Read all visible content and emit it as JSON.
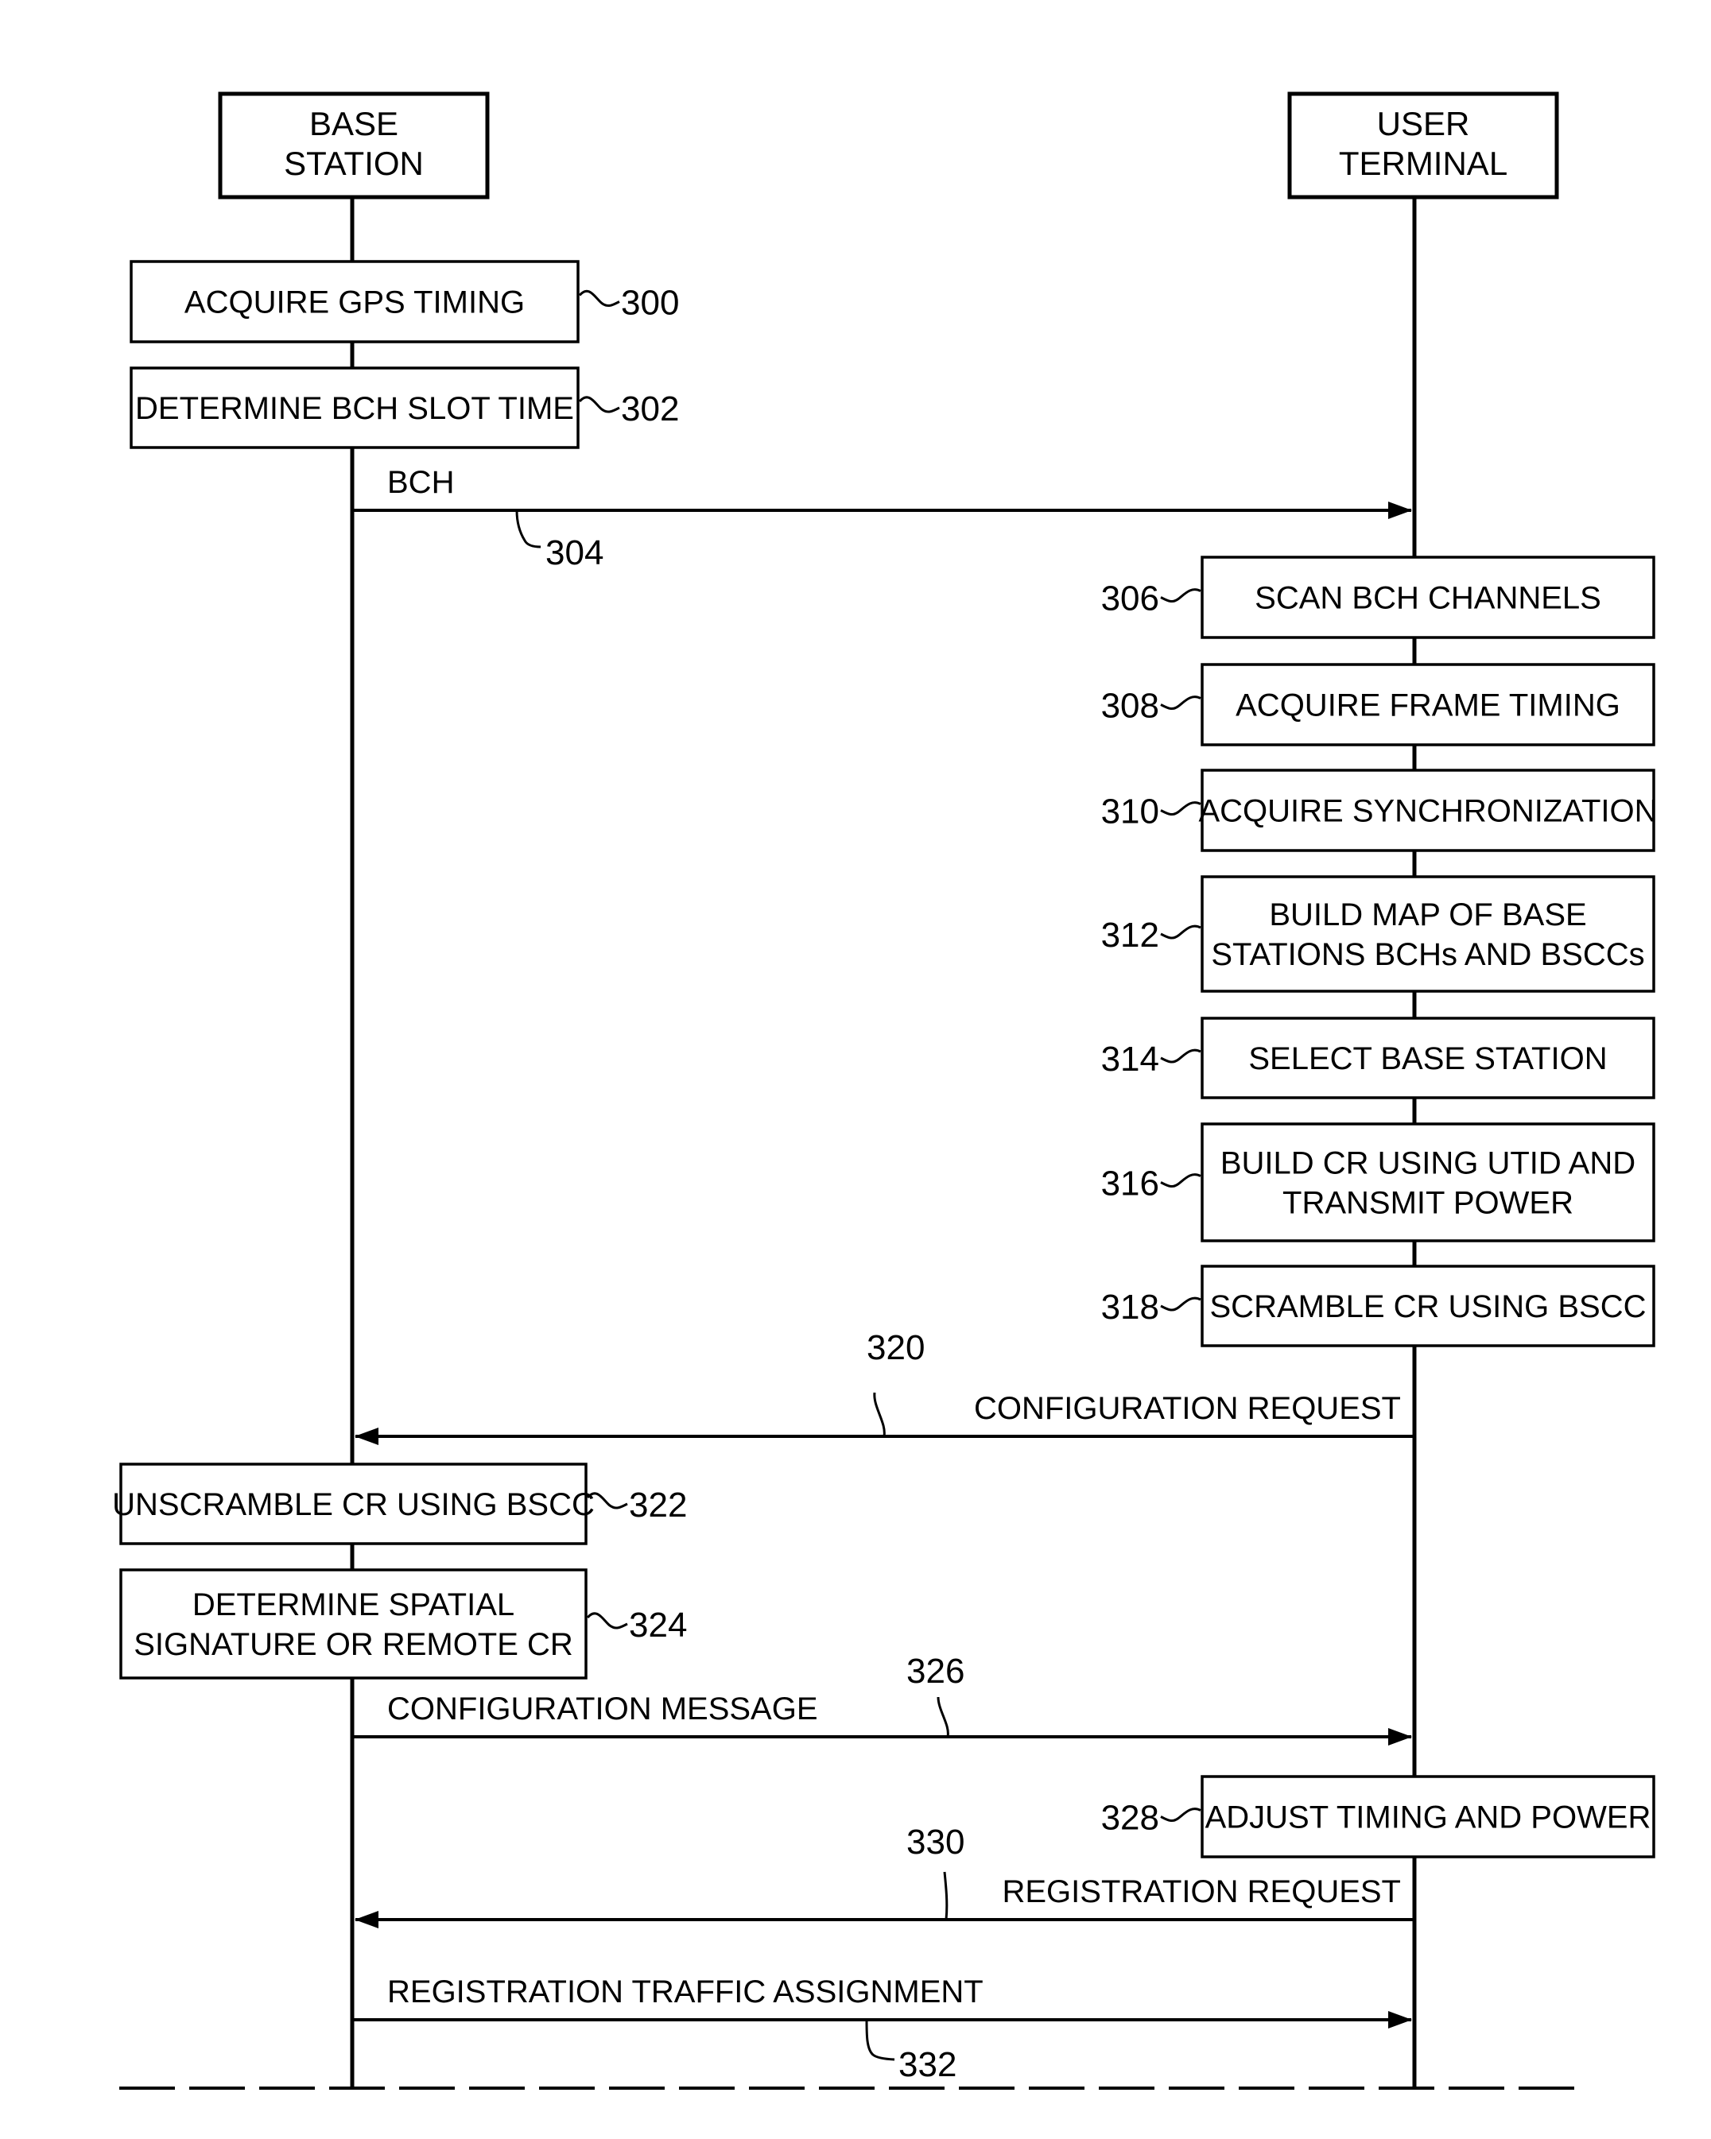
{
  "diagram": {
    "type": "sequence",
    "colors": {
      "ink": "#000000",
      "background": "#ffffff"
    },
    "actors": [
      {
        "id": "base",
        "label_lines": [
          "BASE",
          "STATION"
        ]
      },
      {
        "id": "user",
        "label_lines": [
          "USER",
          "TERMINAL"
        ]
      }
    ],
    "steps": [
      {
        "ref": "300",
        "actor": "base",
        "lines": [
          "ACQUIRE GPS TIMING"
        ]
      },
      {
        "ref": "302",
        "actor": "base",
        "lines": [
          "DETERMINE BCH SLOT TIME"
        ]
      },
      {
        "ref": "306",
        "actor": "user",
        "lines": [
          "SCAN BCH CHANNELS"
        ]
      },
      {
        "ref": "308",
        "actor": "user",
        "lines": [
          "ACQUIRE FRAME TIMING"
        ]
      },
      {
        "ref": "310",
        "actor": "user",
        "lines": [
          "ACQUIRE SYNCHRONIZATION"
        ]
      },
      {
        "ref": "312",
        "actor": "user",
        "lines": [
          "BUILD MAP OF BASE",
          "STATIONS BCHs AND BSCCs"
        ]
      },
      {
        "ref": "314",
        "actor": "user",
        "lines": [
          "SELECT BASE STATION"
        ]
      },
      {
        "ref": "316",
        "actor": "user",
        "lines": [
          "BUILD CR USING UTID AND",
          "TRANSMIT POWER"
        ]
      },
      {
        "ref": "318",
        "actor": "user",
        "lines": [
          "SCRAMBLE CR USING BSCC"
        ]
      },
      {
        "ref": "322",
        "actor": "base",
        "lines": [
          "UNSCRAMBLE CR USING BSCC"
        ]
      },
      {
        "ref": "324",
        "actor": "base",
        "lines": [
          "DETERMINE SPATIAL",
          "SIGNATURE OR REMOTE CR"
        ]
      },
      {
        "ref": "328",
        "actor": "user",
        "lines": [
          "ADJUST TIMING AND POWER"
        ]
      }
    ],
    "messages": [
      {
        "ref": "304",
        "from": "base",
        "to": "user",
        "label": "BCH"
      },
      {
        "ref": "320",
        "from": "user",
        "to": "base",
        "label": "CONFIGURATION REQUEST"
      },
      {
        "ref": "326",
        "from": "base",
        "to": "user",
        "label": "CONFIGURATION MESSAGE"
      },
      {
        "ref": "330",
        "from": "user",
        "to": "base",
        "label": "REGISTRATION REQUEST"
      },
      {
        "ref": "332",
        "from": "base",
        "to": "user",
        "label": "REGISTRATION TRAFFIC ASSIGNMENT"
      }
    ]
  }
}
